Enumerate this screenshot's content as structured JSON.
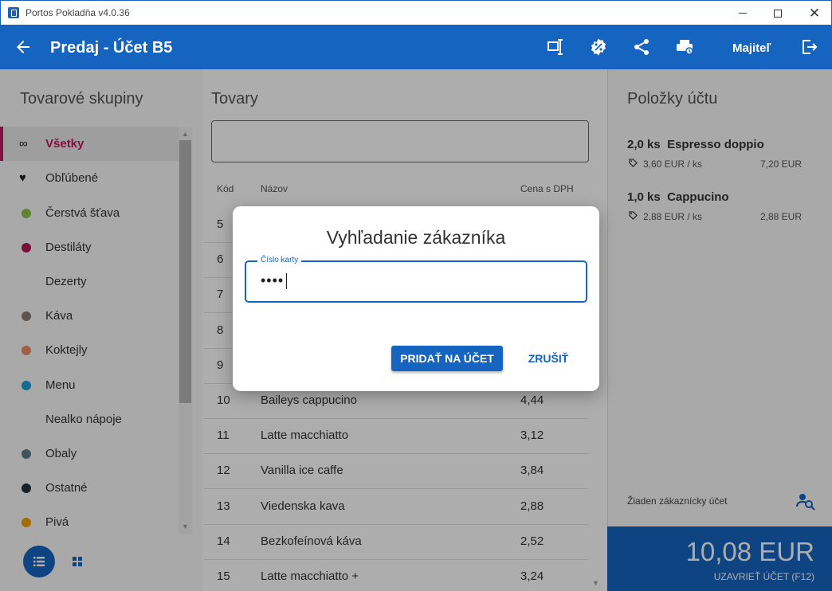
{
  "window": {
    "title": "Portos Pokladňa v4.0.36"
  },
  "header": {
    "title": "Predaj - Účet B5",
    "user": "Majiteľ",
    "icons": [
      "arrow-left-icon",
      "split-bill-icon",
      "discount-icon",
      "share-icon",
      "print-icon",
      "logout-icon"
    ]
  },
  "groups": {
    "title": "Tovarové skupiny",
    "items": [
      {
        "label": "Všetky",
        "icon": "infinity-icon",
        "color": "",
        "active": true
      },
      {
        "label": "Obľúbené",
        "icon": "heart-icon",
        "color": "#111111"
      },
      {
        "label": "Čerstvá šťava",
        "icon": "dot",
        "color": "#8bc34a"
      },
      {
        "label": "Destiláty",
        "icon": "dot",
        "color": "#b0164e"
      },
      {
        "label": "Dezerty",
        "icon": "none",
        "color": ""
      },
      {
        "label": "Káva",
        "icon": "dot",
        "color": "#8d7b73"
      },
      {
        "label": "Koktejly",
        "icon": "dot",
        "color": "#f08a6c"
      },
      {
        "label": "Menu",
        "icon": "dot",
        "color": "#1a9ed8"
      },
      {
        "label": "Nealko nápoje",
        "icon": "none",
        "color": ""
      },
      {
        "label": "Obaly",
        "icon": "dot",
        "color": "#607d8b"
      },
      {
        "label": "Ostatné",
        "icon": "dot",
        "color": "#263238"
      },
      {
        "label": "Pivá",
        "icon": "dot",
        "color": "#f5a000"
      }
    ]
  },
  "products": {
    "title": "Tovary",
    "search_value": "",
    "columns": {
      "code": "Kód",
      "name": "Názov",
      "price": "Cena s DPH"
    },
    "rows": [
      {
        "code": "5",
        "name": "",
        "price": ""
      },
      {
        "code": "6",
        "name": "",
        "price": ""
      },
      {
        "code": "7",
        "name": "",
        "price": ""
      },
      {
        "code": "8",
        "name": "",
        "price": ""
      },
      {
        "code": "9",
        "name": "",
        "price": ""
      },
      {
        "code": "10",
        "name": "Baileys cappucino",
        "price": "4,44"
      },
      {
        "code": "11",
        "name": "Latte macchiatto",
        "price": "3,12"
      },
      {
        "code": "12",
        "name": "Vanilla ice caffe",
        "price": "3,84"
      },
      {
        "code": "13",
        "name": "Viedenska kava",
        "price": "2,88"
      },
      {
        "code": "14",
        "name": "Bezkofeínová káva",
        "price": "2,52"
      },
      {
        "code": "15",
        "name": "Latte macchiatto +",
        "price": "3,24"
      }
    ]
  },
  "bill": {
    "title": "Položky účtu",
    "items": [
      {
        "qty": "2,0 ks",
        "name": "Espresso doppio",
        "unit_price": "3,60 EUR / ks",
        "total": "7,20 EUR"
      },
      {
        "qty": "1,0 ks",
        "name": "Cappucino",
        "unit_price": "2,88 EUR / ks",
        "total": "2,88 EUR"
      }
    ],
    "no_customer": "Žiaden zákaznícky účet",
    "total": "10,08 EUR",
    "close_label": "UZAVRIEŤ ÚČET (F12)"
  },
  "dialog": {
    "title": "Vyhľadanie zákazníka",
    "field_label": "Číslo karty",
    "field_value": "••••",
    "primary_label": "PRIDAŤ NA ÚČET",
    "cancel_label": "ZRUŠIŤ"
  },
  "colors": {
    "brand": "#1565c0",
    "accent": "#c2185b"
  }
}
